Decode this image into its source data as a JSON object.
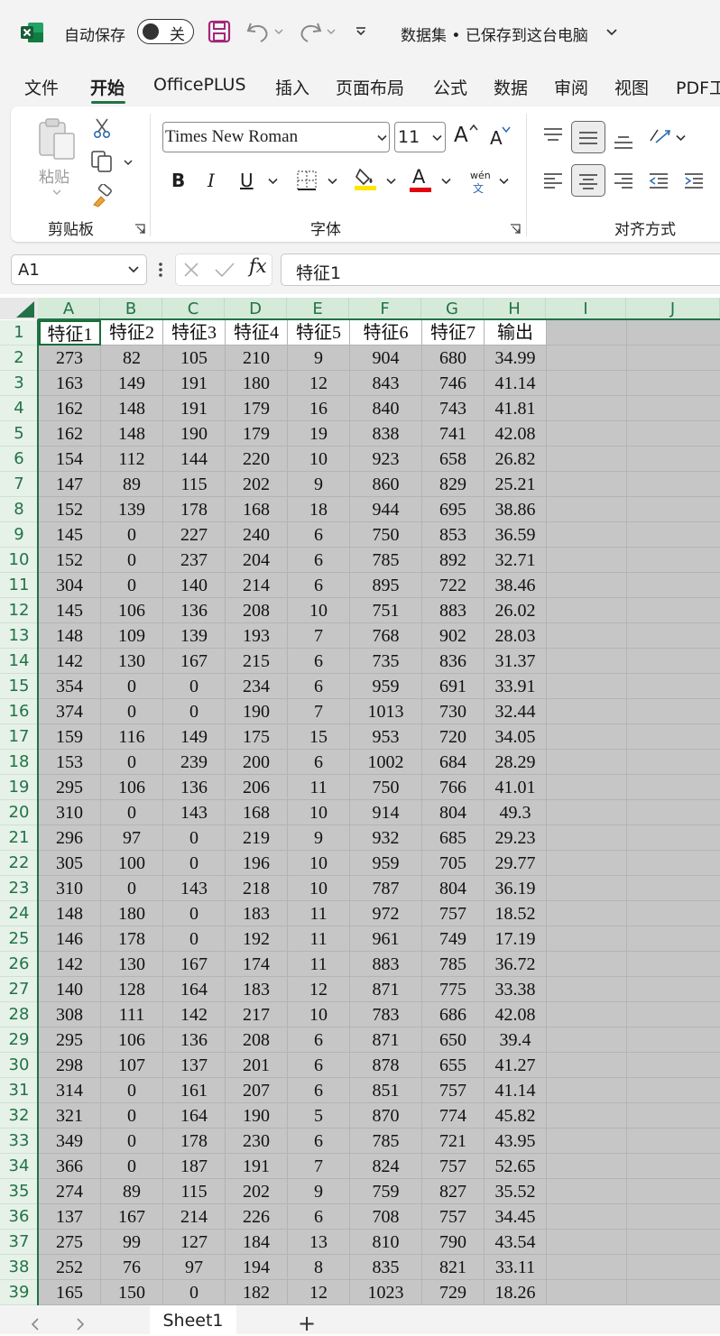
{
  "titlebar": {
    "autosave_label": "自动保存",
    "autosave_state": "关",
    "doc_title": "数据集 • 已保存到这台电脑",
    "accent_color": "#217346"
  },
  "tabs": [
    "文件",
    "开始",
    "OfficePLUS",
    "插入",
    "页面布局",
    "公式",
    "数据",
    "审阅",
    "视图",
    "PDF工"
  ],
  "active_tab": "开始",
  "ribbon": {
    "clipboard": {
      "label": "剪贴板",
      "paste_label": "粘贴"
    },
    "font": {
      "label": "字体",
      "font_name": "Times New Roman",
      "font_size": "11",
      "bold": "B",
      "italic": "I",
      "underline": "U",
      "grow": "A",
      "shrink": "A",
      "color_letter": "A",
      "wen_top": "wén",
      "wen_bottom": "文"
    },
    "alignment": {
      "label": "对齐方式"
    }
  },
  "formula_bar": {
    "name_box": "A1",
    "fx": "fx",
    "content": "特征1"
  },
  "grid": {
    "columns": [
      "A",
      "B",
      "C",
      "D",
      "E",
      "F",
      "G",
      "H",
      "I",
      "J"
    ],
    "header_row": [
      "特征1",
      "特征2",
      "特征3",
      "特征4",
      "特征5",
      "特征6",
      "特征7",
      "输出"
    ],
    "rows": [
      [
        "273",
        "82",
        "105",
        "210",
        "9",
        "904",
        "680",
        "34.99"
      ],
      [
        "163",
        "149",
        "191",
        "180",
        "12",
        "843",
        "746",
        "41.14"
      ],
      [
        "162",
        "148",
        "191",
        "179",
        "16",
        "840",
        "743",
        "41.81"
      ],
      [
        "162",
        "148",
        "190",
        "179",
        "19",
        "838",
        "741",
        "42.08"
      ],
      [
        "154",
        "112",
        "144",
        "220",
        "10",
        "923",
        "658",
        "26.82"
      ],
      [
        "147",
        "89",
        "115",
        "202",
        "9",
        "860",
        "829",
        "25.21"
      ],
      [
        "152",
        "139",
        "178",
        "168",
        "18",
        "944",
        "695",
        "38.86"
      ],
      [
        "145",
        "0",
        "227",
        "240",
        "6",
        "750",
        "853",
        "36.59"
      ],
      [
        "152",
        "0",
        "237",
        "204",
        "6",
        "785",
        "892",
        "32.71"
      ],
      [
        "304",
        "0",
        "140",
        "214",
        "6",
        "895",
        "722",
        "38.46"
      ],
      [
        "145",
        "106",
        "136",
        "208",
        "10",
        "751",
        "883",
        "26.02"
      ],
      [
        "148",
        "109",
        "139",
        "193",
        "7",
        "768",
        "902",
        "28.03"
      ],
      [
        "142",
        "130",
        "167",
        "215",
        "6",
        "735",
        "836",
        "31.37"
      ],
      [
        "354",
        "0",
        "0",
        "234",
        "6",
        "959",
        "691",
        "33.91"
      ],
      [
        "374",
        "0",
        "0",
        "190",
        "7",
        "1013",
        "730",
        "32.44"
      ],
      [
        "159",
        "116",
        "149",
        "175",
        "15",
        "953",
        "720",
        "34.05"
      ],
      [
        "153",
        "0",
        "239",
        "200",
        "6",
        "1002",
        "684",
        "28.29"
      ],
      [
        "295",
        "106",
        "136",
        "206",
        "11",
        "750",
        "766",
        "41.01"
      ],
      [
        "310",
        "0",
        "143",
        "168",
        "10",
        "914",
        "804",
        "49.3"
      ],
      [
        "296",
        "97",
        "0",
        "219",
        "9",
        "932",
        "685",
        "29.23"
      ],
      [
        "305",
        "100",
        "0",
        "196",
        "10",
        "959",
        "705",
        "29.77"
      ],
      [
        "310",
        "0",
        "143",
        "218",
        "10",
        "787",
        "804",
        "36.19"
      ],
      [
        "148",
        "180",
        "0",
        "183",
        "11",
        "972",
        "757",
        "18.52"
      ],
      [
        "146",
        "178",
        "0",
        "192",
        "11",
        "961",
        "749",
        "17.19"
      ],
      [
        "142",
        "130",
        "167",
        "174",
        "11",
        "883",
        "785",
        "36.72"
      ],
      [
        "140",
        "128",
        "164",
        "183",
        "12",
        "871",
        "775",
        "33.38"
      ],
      [
        "308",
        "111",
        "142",
        "217",
        "10",
        "783",
        "686",
        "42.08"
      ],
      [
        "295",
        "106",
        "136",
        "208",
        "6",
        "871",
        "650",
        "39.4"
      ],
      [
        "298",
        "107",
        "137",
        "201",
        "6",
        "878",
        "655",
        "41.27"
      ],
      [
        "314",
        "0",
        "161",
        "207",
        "6",
        "851",
        "757",
        "41.14"
      ],
      [
        "321",
        "0",
        "164",
        "190",
        "5",
        "870",
        "774",
        "45.82"
      ],
      [
        "349",
        "0",
        "178",
        "230",
        "6",
        "785",
        "721",
        "43.95"
      ],
      [
        "366",
        "0",
        "187",
        "191",
        "7",
        "824",
        "757",
        "52.65"
      ],
      [
        "274",
        "89",
        "115",
        "202",
        "9",
        "759",
        "827",
        "35.52"
      ],
      [
        "137",
        "167",
        "214",
        "226",
        "6",
        "708",
        "757",
        "34.45"
      ],
      [
        "275",
        "99",
        "127",
        "184",
        "13",
        "810",
        "790",
        "43.54"
      ],
      [
        "252",
        "76",
        "97",
        "194",
        "8",
        "835",
        "821",
        "33.11"
      ],
      [
        "165",
        "150",
        "0",
        "182",
        "12",
        "1023",
        "729",
        "18.26"
      ]
    ]
  },
  "sheets": {
    "active": "Sheet1",
    "add_symbol": "+"
  }
}
